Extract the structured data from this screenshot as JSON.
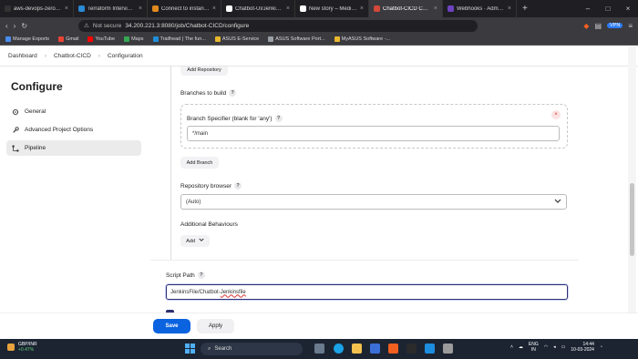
{
  "browser": {
    "tabs": [
      {
        "label": "aws-devops-zero-to-hero",
        "color": "#333333",
        "active": false
      },
      {
        "label": "Terraform Interview Q&A",
        "color": "#2a8ad4",
        "active": false
      },
      {
        "label": "Connect to instance | EC2",
        "color": "#e08a1e",
        "active": false
      },
      {
        "label": "Chatbot-UI/JenkinsFile/C",
        "color": "#ffffff",
        "active": false
      },
      {
        "label": "New story – Medium",
        "color": "#ffffff",
        "active": false
      },
      {
        "label": "Chatbot-CICD Config",
        "color": "#d24939",
        "active": true
      },
      {
        "label": "Webhooks · Administrati",
        "color": "#6f42c1",
        "active": false
      }
    ],
    "security_label": "Not secure",
    "url": "34.200.221.3:8080/job/Chatbot-CICD/configure",
    "vpn_label": "VPN",
    "bookmarks": [
      {
        "label": "Manage Exports",
        "color": "#4a8df0"
      },
      {
        "label": "Gmail",
        "color": "#ea4335"
      },
      {
        "label": "YouTube",
        "color": "#ff0000"
      },
      {
        "label": "Maps",
        "color": "#34a853"
      },
      {
        "label": "Trailhead | The fun...",
        "color": "#1e8fd8"
      },
      {
        "label": "ASUS E-Service",
        "color": "#e8b72e"
      },
      {
        "label": "ASUS Software Port...",
        "color": "#9aa0a6"
      },
      {
        "label": "MyASUS Software -...",
        "color": "#e8b72e"
      }
    ]
  },
  "breadcrumb": {
    "items": [
      "Dashboard",
      "Chatbot-CICD",
      "Configuration"
    ]
  },
  "sidebar": {
    "title": "Configure",
    "items": [
      {
        "label": "General",
        "active": false,
        "icon": "gear-icon"
      },
      {
        "label": "Advanced Project Options",
        "active": false,
        "icon": "wrench-icon"
      },
      {
        "label": "Pipeline",
        "active": true,
        "icon": "pipeline-icon"
      }
    ]
  },
  "form": {
    "add_repository_label": "Add Repository",
    "branches_label": "Branches to build",
    "branch_spec_label": "Branch Specifier (blank for 'any')",
    "branch_spec_value": "*/main",
    "add_branch_label": "Add Branch",
    "repo_browser_label": "Repository browser",
    "repo_browser_value": "(Auto)",
    "additional_behaviours_label": "Additional Behaviours",
    "add_label": "Add",
    "script_path_label": "Script Path",
    "script_path_value_prefix": "JenkinsFile/Chatbot-",
    "script_path_value_suffix": "Jenkinsfile",
    "help_symbol": "?"
  },
  "footer": {
    "save_label": "Save",
    "apply_label": "Apply"
  },
  "taskbar": {
    "stock_name": "GBP/INR",
    "stock_change": "+0.47%",
    "search_placeholder": "Search",
    "lang_top": "ENG",
    "lang_bottom": "IN",
    "time": "14:44",
    "date": "10-03-2024"
  }
}
